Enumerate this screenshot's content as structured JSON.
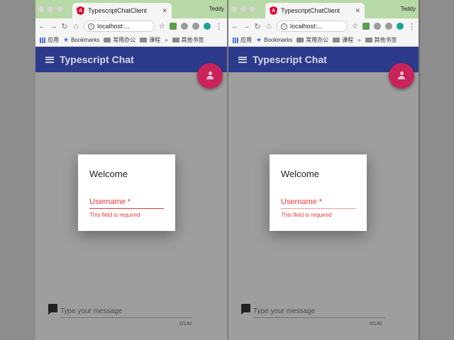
{
  "browser": {
    "tab_title": "TypescriptChatClient",
    "profile_name": "Teddy",
    "url": "localhost:...",
    "bookmarks": {
      "apps_label": "应用",
      "bookmarks_label": "Bookmarks",
      "folder_1": "常用办公",
      "folder_2": "课程",
      "more": "»",
      "other_bookmarks": "其他书签"
    }
  },
  "app": {
    "title": "Typescript Chat",
    "accent_color": "#2c3a8c",
    "fab_color": "#c9245a"
  },
  "dialog": {
    "title": "Welcome",
    "username_label": "Username *",
    "error_text": "This field is required",
    "error_color": "#e53935"
  },
  "message": {
    "placeholder": "Type your message",
    "counter": "0/140"
  }
}
